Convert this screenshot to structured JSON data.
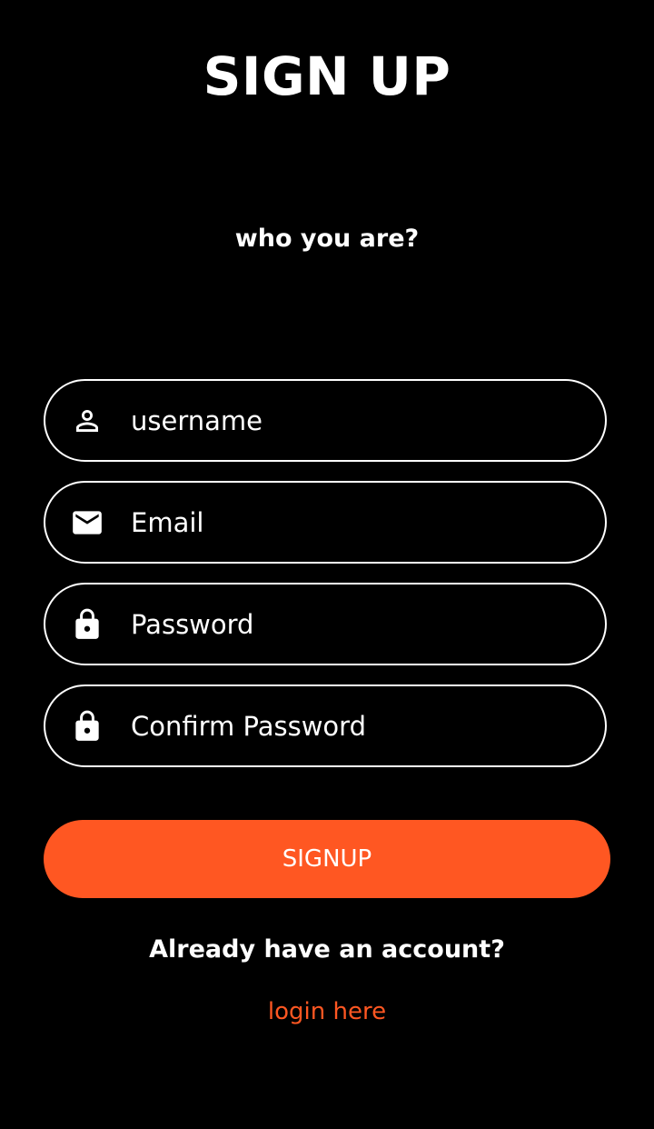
{
  "header": {
    "title": "SIGN UP",
    "subtitle": "who you are?"
  },
  "form": {
    "username": {
      "placeholder": "username",
      "value": "",
      "icon": "person-icon"
    },
    "email": {
      "placeholder": "Email",
      "value": "",
      "icon": "mail-icon"
    },
    "password": {
      "placeholder": "Password",
      "value": "",
      "icon": "lock-icon"
    },
    "confirm_password": {
      "placeholder": "Confirm Password",
      "value": "",
      "icon": "lock-icon"
    },
    "submit_label": "SIGNUP"
  },
  "footer": {
    "prompt": "Already have an account?",
    "login_link": "login here"
  },
  "colors": {
    "background": "#000000",
    "accent": "#FF5722",
    "text": "#FFFFFF"
  }
}
